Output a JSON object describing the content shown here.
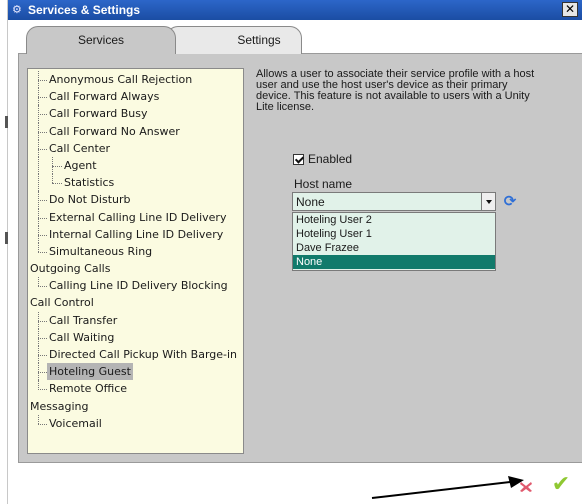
{
  "window": {
    "title": "Services & Settings",
    "close_glyph": "✕"
  },
  "tabs": [
    {
      "label": "Services",
      "active": true
    },
    {
      "label": "Settings",
      "active": false
    }
  ],
  "tree": [
    {
      "label": "Anonymous Call Rejection"
    },
    {
      "label": "Call Forward Always"
    },
    {
      "label": "Call Forward Busy"
    },
    {
      "label": "Call Forward No Answer"
    },
    {
      "label": "Call Center"
    },
    {
      "label": "Agent"
    },
    {
      "label": "Statistics"
    },
    {
      "label": "Do Not Disturb"
    },
    {
      "label": "External Calling Line ID Delivery"
    },
    {
      "label": "Internal Calling Line ID Delivery"
    },
    {
      "label": "Simultaneous Ring"
    },
    {
      "label": "Outgoing Calls"
    },
    {
      "label": "Calling Line ID Delivery Blocking"
    },
    {
      "label": "Call Control"
    },
    {
      "label": "Call Transfer"
    },
    {
      "label": "Call Waiting"
    },
    {
      "label": "Directed Call Pickup With Barge-in"
    },
    {
      "label": "Hoteling Guest",
      "selected": true
    },
    {
      "label": "Remote Office"
    },
    {
      "label": "Messaging"
    },
    {
      "label": "Voicemail"
    }
  ],
  "detail": {
    "description_lines": [
      "Allows a user to associate their service profile with a host",
      "user and use the host user's device as their primary",
      "device.  This feature is not available to users with a Unity",
      "Lite license."
    ],
    "enabled_label": "Enabled",
    "enabled_checked": true,
    "host_label": "Host name",
    "host_value": "None",
    "options": [
      "Hoteling User 2",
      "Hoteling User 1",
      "Dave Frazee",
      "None"
    ],
    "active_option": "None"
  },
  "actions": {
    "ok_glyph": "✔"
  },
  "icons": {
    "window": "settings-gears-icon",
    "refresh": "refresh-icon",
    "cancel": "cancel-icon",
    "ok": "checkmark-icon"
  },
  "colors": {
    "titlebar": "#1f58b8",
    "tree_bg": "#fbfbe1",
    "panel_bg": "#c8c8c8",
    "select_bg": "#e1f2e9",
    "option_active": "#117a6b",
    "ok_green": "#8fc832"
  }
}
